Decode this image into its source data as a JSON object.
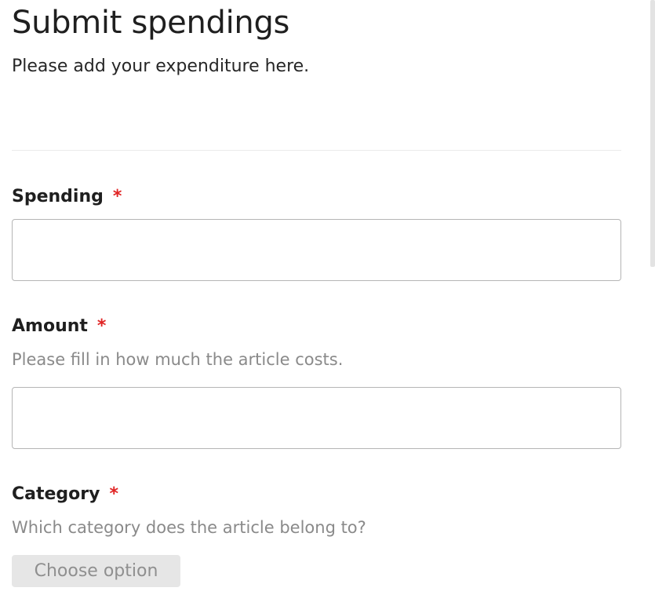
{
  "header": {
    "title": "Submit spendings",
    "subtitle": "Please add your expenditure here."
  },
  "fields": [
    {
      "label": "Spending",
      "required_marker": "*",
      "value": "",
      "placeholder": ""
    },
    {
      "label": "Amount",
      "required_marker": "*",
      "hint": "Please fill in how much the article costs.",
      "value": "",
      "placeholder": ""
    },
    {
      "label": "Category",
      "required_marker": "*",
      "hint": "Which category does the article belong to?",
      "select_label": "Choose option"
    }
  ],
  "colors": {
    "required": "#e02424",
    "hint": "#8a8a8a",
    "input_border": "#b5b5b5",
    "select_background": "#e6e6e6"
  }
}
